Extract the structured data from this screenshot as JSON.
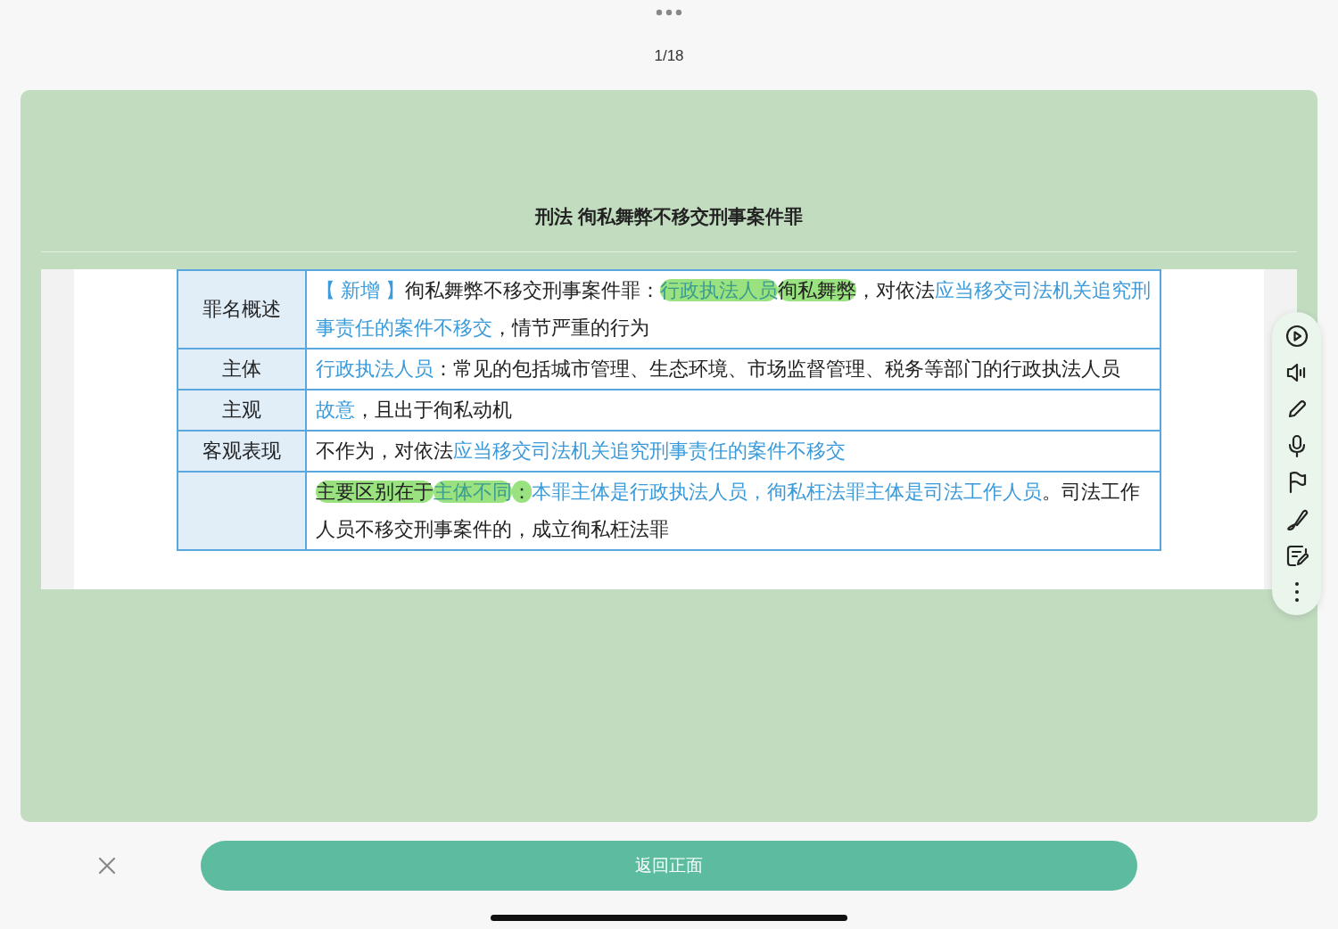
{
  "page_counter": "1/18",
  "card": {
    "title": "刑法 徇私舞弊不移交刑事案件罪",
    "table": {
      "rows": [
        {
          "header": "罪名概述",
          "content": [
            {
              "kind": "blue",
              "text": "【 新增 】"
            },
            {
              "kind": "plain",
              "text": "徇私舞弊不移交刑事案件罪："
            },
            {
              "kind": "mark-blue",
              "text": "行政执法人员"
            },
            {
              "kind": "mark",
              "text": "徇私舞弊"
            },
            {
              "kind": "plain",
              "text": "，对依法"
            },
            {
              "kind": "blue",
              "text": "应当移交司法机关追究刑事责任的案件不移交"
            },
            {
              "kind": "plain",
              "text": "，情节严重的行为"
            }
          ]
        },
        {
          "header": "主体",
          "content": [
            {
              "kind": "blue",
              "text": "行政执法人员"
            },
            {
              "kind": "plain",
              "text": "：常见的包括城市管理、生态环境、市场监督管理、税务等部门的行政执法人员"
            }
          ]
        },
        {
          "header": "主观",
          "content": [
            {
              "kind": "blue",
              "text": "故意"
            },
            {
              "kind": "plain",
              "text": "，且出于徇私动机"
            }
          ]
        },
        {
          "header": "客观表现",
          "content": [
            {
              "kind": "plain",
              "text": "不作为，对依法"
            },
            {
              "kind": "blue",
              "text": "应当移交司法机关追究刑事责任的案件不移交"
            }
          ]
        },
        {
          "content": [
            {
              "kind": "mark",
              "text": "主要区别在于"
            },
            {
              "kind": "mark-blue",
              "text": "主体不同"
            },
            {
              "kind": "mark",
              "text": "："
            },
            {
              "kind": "blue",
              "text": "本罪主体是行政执法人员，徇私枉法罪主体是司法工作人员"
            },
            {
              "kind": "plain",
              "text": "。司法工作人员不移交刑事案件的，成立徇私枉法罪"
            }
          ]
        }
      ]
    }
  },
  "footer": {
    "button": "返回正面"
  }
}
